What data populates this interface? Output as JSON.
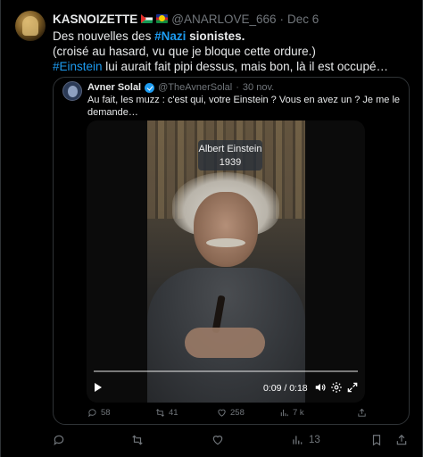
{
  "tweet": {
    "author_name": "KASNOIZETTE",
    "handle": "@ANARLOVE_666",
    "separator": "·",
    "date": "Dec 6",
    "line1_pre": "Des nouvelles des ",
    "line1_hashtag": "#Nazi",
    "line1_bold": " sionistes.",
    "line2": "(croisé au hasard, vu que je bloque cette ordure.)",
    "line3_hashtag": "#Einstein",
    "line3_rest": " lui aurait fait pipi dessus, mais bon, là il est occupé…"
  },
  "quote": {
    "author_name": "Avner Solal",
    "handle": "@TheAvnerSolal",
    "separator": "·",
    "date": "30 nov.",
    "text": "Au fait, les muzz : c'est qui, votre Einstein ? Vous en avez un ? Je me le demande…",
    "video": {
      "caption_name": "Albert Einstein",
      "caption_year": "1939",
      "time": "0:09 / 0:18",
      "progress": 0
    },
    "actions": {
      "replies": "58",
      "retweets": "41",
      "likes": "258",
      "views": "7 k"
    }
  },
  "actions": {
    "views": "13"
  },
  "colors": {
    "background": "#000000",
    "text": "#e7e9ea",
    "muted": "#71767b",
    "accent": "#1d9bf0",
    "border": "#2f3336"
  }
}
